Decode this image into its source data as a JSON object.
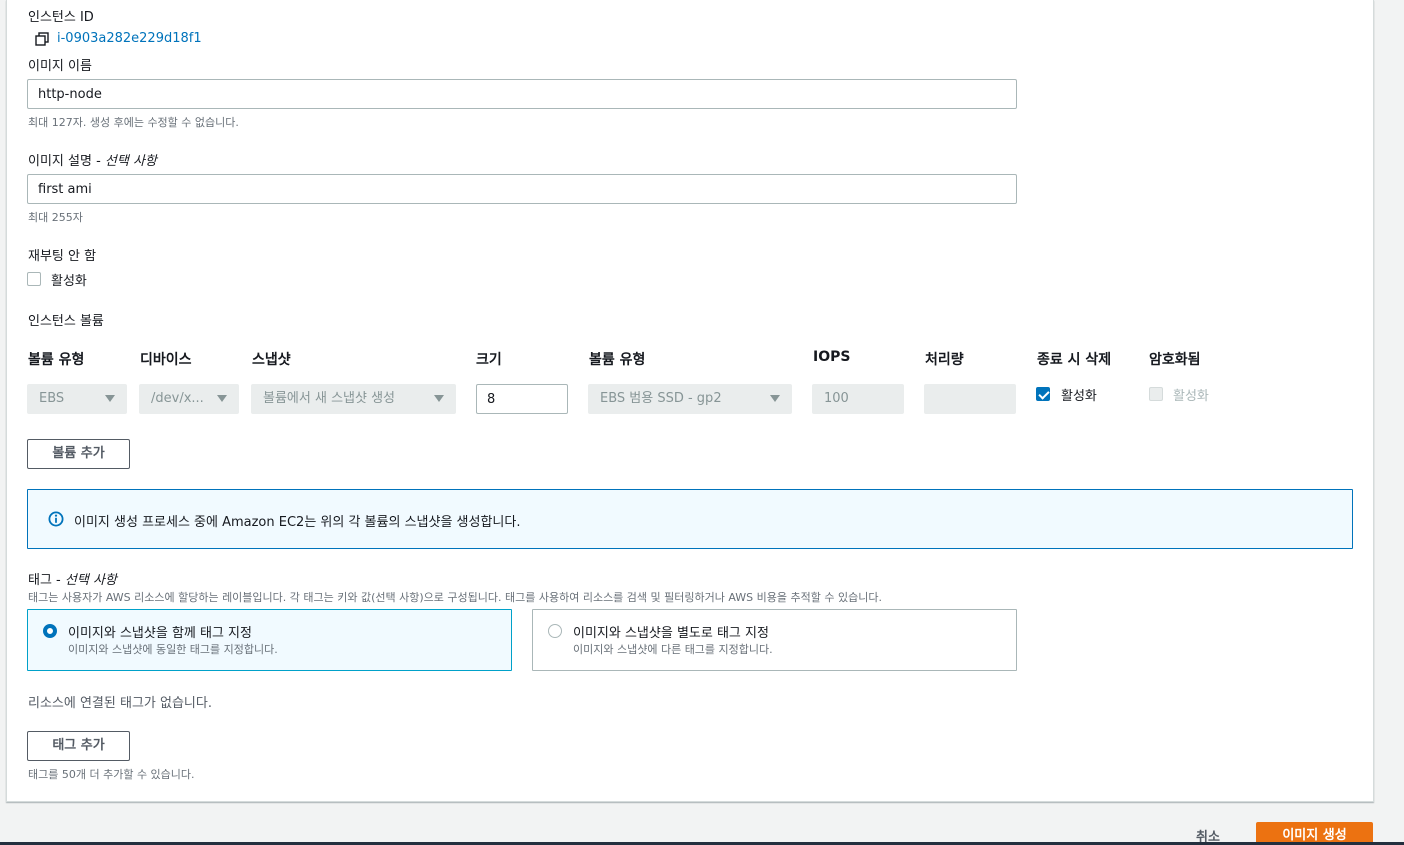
{
  "instance": {
    "label": "인스턴스 ID",
    "id": "i-0903a282e229d18f1",
    "copy_icon": "copy-icon"
  },
  "image_name": {
    "label": "이미지 이름",
    "value": "http-node",
    "hint": "최대 127자. 생성 후에는 수정할 수 없습니다."
  },
  "image_description": {
    "label": "이미지 설명 - ",
    "label_optional": "선택 사항",
    "value": "first ami",
    "hint": "최대 255자"
  },
  "no_reboot": {
    "label": "재부팅 안 함",
    "checkbox_label": "활성화",
    "checked": false
  },
  "volumes": {
    "section_label": "인스턴스 볼륨",
    "columns": [
      "볼륨 유형",
      "디바이스",
      "스냅샷",
      "크기",
      "볼륨 유형",
      "IOPS",
      "처리량",
      "종료 시 삭제",
      "암호화됨"
    ],
    "row": {
      "volume_type": "EBS",
      "device": "/dev/x...",
      "snapshot": "볼륨에서 새 스냅샷 생성",
      "size": "8",
      "ebs_type": "EBS 범용 SSD - gp2",
      "iops": "100",
      "throughput": "",
      "delete_on_termination": "활성화",
      "delete_checked": true,
      "encrypted": "활성화",
      "encrypted_checked": false
    },
    "add_button": "볼륨 추가"
  },
  "info": {
    "icon": "info-icon",
    "text": "이미지 생성 프로세스 중에 Amazon EC2는 위의 각 볼륨의 스냅샷을 생성합니다."
  },
  "tags": {
    "label": "태그 - ",
    "label_optional": "선택 사항",
    "description": "태그는 사용자가 AWS 리소스에 할당하는 레이블입니다. 각 태그는 키와 값(선택 사항)으로 구성됩니다. 태그를 사용하여 리소스를 검색 및 필터링하거나 AWS 비용을 추적할 수 있습니다.",
    "options": [
      {
        "title": "이미지와 스냅샷을 함께 태그 지정",
        "desc": "이미지와 스냅샷에 동일한 태그를 지정합니다.",
        "selected": true
      },
      {
        "title": "이미지와 스냅샷을 별도로 태그 지정",
        "desc": "이미지와 스냅샷에 다른 태그를 지정합니다.",
        "selected": false
      }
    ],
    "empty_text": "리소스에 연결된 태그가 없습니다.",
    "add_button": "태그 추가",
    "add_hint": "태그를 50개 더 추가할 수 있습니다."
  },
  "footer": {
    "cancel": "취소",
    "create": "이미지 생성"
  },
  "colors": {
    "accent": "#0073bb",
    "primary_button": "#ec7211",
    "link": "#0073bb"
  }
}
